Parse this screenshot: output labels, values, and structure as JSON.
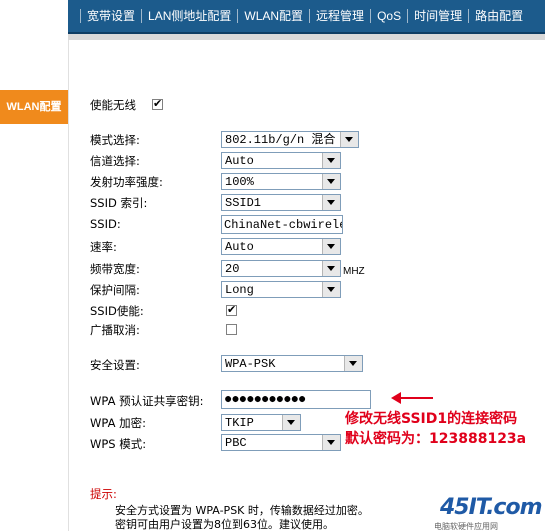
{
  "nav": {
    "items": [
      "宽带设置",
      "LAN侧地址配置",
      "WLAN配置",
      "远程管理",
      "QoS",
      "时间管理",
      "路由配置"
    ]
  },
  "sidebar": {
    "active_tab": "WLAN配置"
  },
  "form": {
    "enable_wireless_label": "使能无线",
    "mode_label": "模式选择:",
    "mode_value": "802.11b/g/n 混合",
    "channel_label": "信道选择:",
    "channel_value": "Auto",
    "power_label": "发射功率强度:",
    "power_value": "100%",
    "ssid_index_label": "SSID 索引:",
    "ssid_index_value": "SSID1",
    "ssid_label": "SSID:",
    "ssid_value": "ChinaNet-cbwirele",
    "rate_label": "速率:",
    "rate_value": "Auto",
    "bandwidth_label": "频带宽度:",
    "bandwidth_value": "20",
    "bandwidth_unit": "MHZ",
    "guard_label": "保护间隔:",
    "guard_value": "Long",
    "ssid_enable_label": "SSID使能:",
    "broadcast_cancel_label": "广播取消:",
    "security_label": "安全设置:",
    "security_value": "WPA-PSK",
    "psk_label": "WPA 预认证共享密钥:",
    "psk_value": "●●●●●●●●●●●",
    "encryption_label": "WPA 加密:",
    "encryption_value": "TKIP",
    "wps_label": "WPS 模式:",
    "wps_value": "PBC"
  },
  "annotation": {
    "line1": "修改无线SSID1的连接密码",
    "line2": "默认密码为：123888123a"
  },
  "hint": {
    "title": "提示:",
    "line1": "安全方式设置为 WPA-PSK 时，传输数据经过加密。",
    "line2": "密钥可由用户设置为8位到63位。建议使用。"
  },
  "watermark": {
    "logo": "45IT.com",
    "subtitle": "电脑软硬件应用网"
  },
  "colors": {
    "nav_bg": "#1c5b8c",
    "sidebar_tab": "#f08a1c",
    "annotation_red": "#e0001b"
  }
}
